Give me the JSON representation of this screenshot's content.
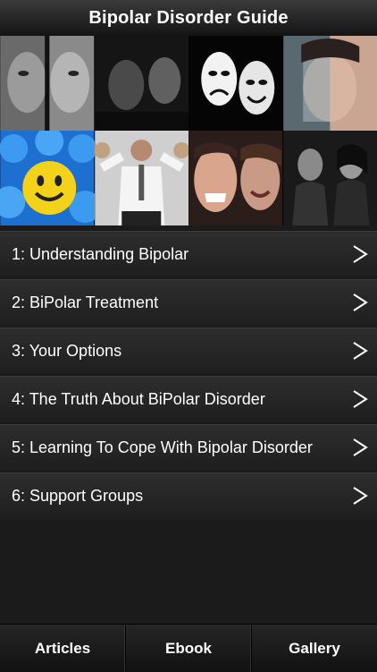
{
  "header": {
    "title": "Bipolar Disorder Guide"
  },
  "menu": {
    "items": [
      {
        "label": "1: Understanding Bipolar"
      },
      {
        "label": "2: BiPolar Treatment"
      },
      {
        "label": "3: Your Options"
      },
      {
        "label": "4: The Truth About BiPolar Disorder"
      },
      {
        "label": "5: Learning To Cope With Bipolar Disorder"
      },
      {
        "label": "6: Support Groups"
      }
    ],
    "chevron_icon": "chevron-right-icon"
  },
  "tabs": [
    {
      "label": "Articles"
    },
    {
      "label": "Ebook"
    },
    {
      "label": "Gallery"
    }
  ],
  "colors": {
    "background": "#1b1b1b",
    "text": "#ffffff",
    "bar": "#141414"
  }
}
